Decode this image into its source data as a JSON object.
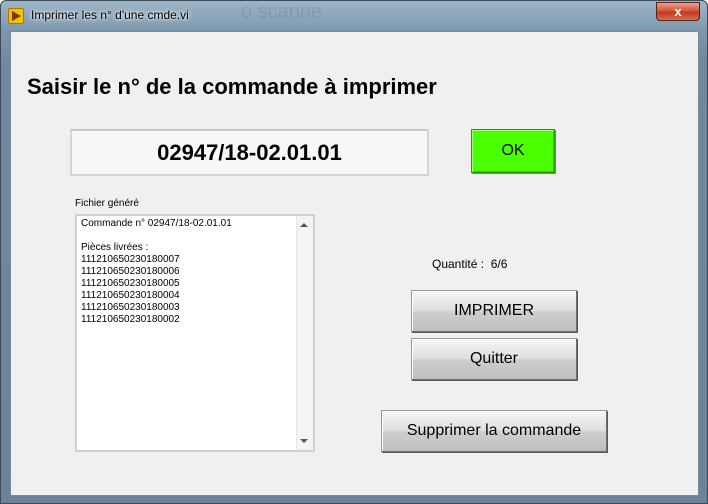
{
  "window": {
    "title": "Imprimer les n° d'une cmde.vi",
    "close_label": "x",
    "ghost_title": "o scanne"
  },
  "heading": "Saisir le n° de la commande à imprimer",
  "order_number": "02947/18-02.01.01",
  "ok_label": "OK",
  "file": {
    "label": "Fichier généré",
    "lines": [
      "Commande n° 02947/18-02.01.01",
      "",
      "Pièces livrées :",
      "111210650230180007",
      "111210650230180006",
      "111210650230180005",
      "111210650230180004",
      "111210650230180003",
      "111210650230180002"
    ]
  },
  "quantity": {
    "label": "Quantité :",
    "value": "6/6"
  },
  "buttons": {
    "print": "IMPRIMER",
    "quit": "Quitter",
    "delete": "Supprimer la commande"
  },
  "colors": {
    "ok_button": "#4cff00",
    "client_background": "#f0f0f0"
  }
}
